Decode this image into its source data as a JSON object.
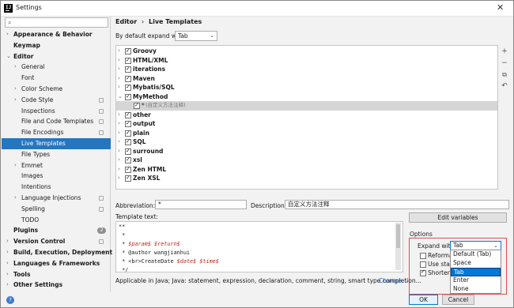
{
  "window": {
    "title": "Settings",
    "close_glyph": "✕",
    "app_icon_letters": "IJ"
  },
  "sidebar": {
    "search_placeholder": "",
    "items": [
      {
        "label": "Appearance & Behavior",
        "bold": true,
        "arrow": "›"
      },
      {
        "label": "Keymap",
        "bold": true
      },
      {
        "label": "Editor",
        "bold": true,
        "arrow": "⌄"
      },
      {
        "label": "General",
        "arrow": "›"
      },
      {
        "label": "Font"
      },
      {
        "label": "Color Scheme",
        "arrow": "›"
      },
      {
        "label": "Code Style",
        "arrow": "›",
        "project": true
      },
      {
        "label": "Inspections",
        "project": true
      },
      {
        "label": "File and Code Templates",
        "project": true
      },
      {
        "label": "File Encodings",
        "project": true
      },
      {
        "label": "Live Templates",
        "selected": true
      },
      {
        "label": "File Types"
      },
      {
        "label": "Emmet",
        "arrow": "›"
      },
      {
        "label": "Images"
      },
      {
        "label": "Intentions"
      },
      {
        "label": "Language Injections",
        "arrow": "›",
        "project": true
      },
      {
        "label": "Spelling",
        "project": true
      },
      {
        "label": "TODO"
      },
      {
        "label": "Plugins",
        "bold": true,
        "badge": "2"
      },
      {
        "label": "Version Control",
        "bold": true,
        "arrow": "›",
        "project": true
      },
      {
        "label": "Build, Execution, Deployment",
        "bold": true,
        "arrow": "›"
      },
      {
        "label": "Languages & Frameworks",
        "bold": true,
        "arrow": "›"
      },
      {
        "label": "Tools",
        "bold": true,
        "arrow": "›"
      },
      {
        "label": "Other Settings",
        "bold": true,
        "arrow": "›"
      }
    ],
    "help_glyph": "?"
  },
  "breadcrumb": {
    "parent": "Editor",
    "sep": "›",
    "current": "Live Templates"
  },
  "default_expand": {
    "label": "By default expand with",
    "value": "Tab"
  },
  "template_groups": [
    {
      "label": "Groovy",
      "checked": true
    },
    {
      "label": "HTML/XML",
      "checked": true
    },
    {
      "label": "iterations",
      "checked": true
    },
    {
      "label": "Maven",
      "checked": true
    },
    {
      "label": "Mybatis/SQL",
      "checked": true
    },
    {
      "label": "MyMethod",
      "checked": true,
      "expanded": true,
      "children": [
        {
          "abbr": "*",
          "desc": "(自定义方法注释)",
          "checked": true
        }
      ]
    },
    {
      "label": "other",
      "checked": true
    },
    {
      "label": "output",
      "checked": true
    },
    {
      "label": "plain",
      "checked": true
    },
    {
      "label": "SQL",
      "checked": true
    },
    {
      "label": "surround",
      "checked": true
    },
    {
      "label": "xsl",
      "checked": true
    },
    {
      "label": "Zen HTML",
      "checked": true
    },
    {
      "label": "Zen XSL",
      "checked": true
    }
  ],
  "toolbar": {
    "add": "+",
    "remove": "−",
    "copy": "⧉",
    "restore": "↶"
  },
  "abbreviation": {
    "label": "Abbreviation:",
    "value": "*"
  },
  "description": {
    "label": "Description:",
    "value": "自定义方法注释"
  },
  "template_text": {
    "label": "Template text:",
    "lines": [
      {
        "text": "**"
      },
      {
        "text": " *"
      },
      {
        "pre": " * ",
        "vars": "$param$ $return$"
      },
      {
        "text": " * @author wangjianhui"
      },
      {
        "pre": " * <br>CreateDate ",
        "vars": "$date$ $time$"
      },
      {
        "text": " */"
      }
    ]
  },
  "edit_variables_button": "Edit variables",
  "options": {
    "title": "Options",
    "expand_with_label": "Expand with",
    "expand_with_value": "Tab",
    "reformat": {
      "label": "Reformat",
      "checked": false
    },
    "use_static": {
      "label": "Use static",
      "checked": false
    },
    "shorten": {
      "label": "Shorten",
      "checked": true
    },
    "dropdown": [
      "Default (Tab)",
      "Space",
      "Tab",
      "Enter",
      "None"
    ],
    "dropdown_selected_index": 2
  },
  "applicable": {
    "text": "Applicable in Java; Java: statement, expression, declaration, comment, string, smart type completion...",
    "change": "Change",
    "change_arrow": "⌄"
  },
  "buttons": {
    "ok": "OK",
    "cancel": "Cancel"
  }
}
